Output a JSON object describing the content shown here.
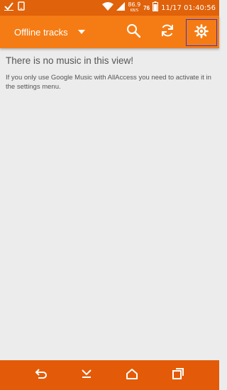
{
  "status_bar": {
    "speed_value": "86.9",
    "speed_unit": "KB/S",
    "battery_level": "76",
    "datetime": "11/17 01:40:56"
  },
  "app_bar": {
    "spinner_label": "Offline tracks"
  },
  "content": {
    "empty_title": "There is no music in this view!",
    "empty_description": "If you only use Google Music with AllAccess you need to activate it in the settings menu."
  },
  "colors": {
    "status_bar": "#e0620a",
    "app_bar": "#f57c14",
    "nav_bar": "#e35b08",
    "background": "#ececec",
    "highlight_box": "#3b34c8"
  },
  "icons": {
    "status_left": [
      "check-icon",
      "phone-icon"
    ],
    "status_right": [
      "wifi-icon",
      "signal-icon",
      "battery-icon"
    ],
    "actions": [
      "search-icon",
      "sync-icon",
      "gear-icon"
    ],
    "nav": [
      "back-icon",
      "hide-keyboard-icon",
      "home-icon",
      "recent-apps-icon"
    ]
  }
}
